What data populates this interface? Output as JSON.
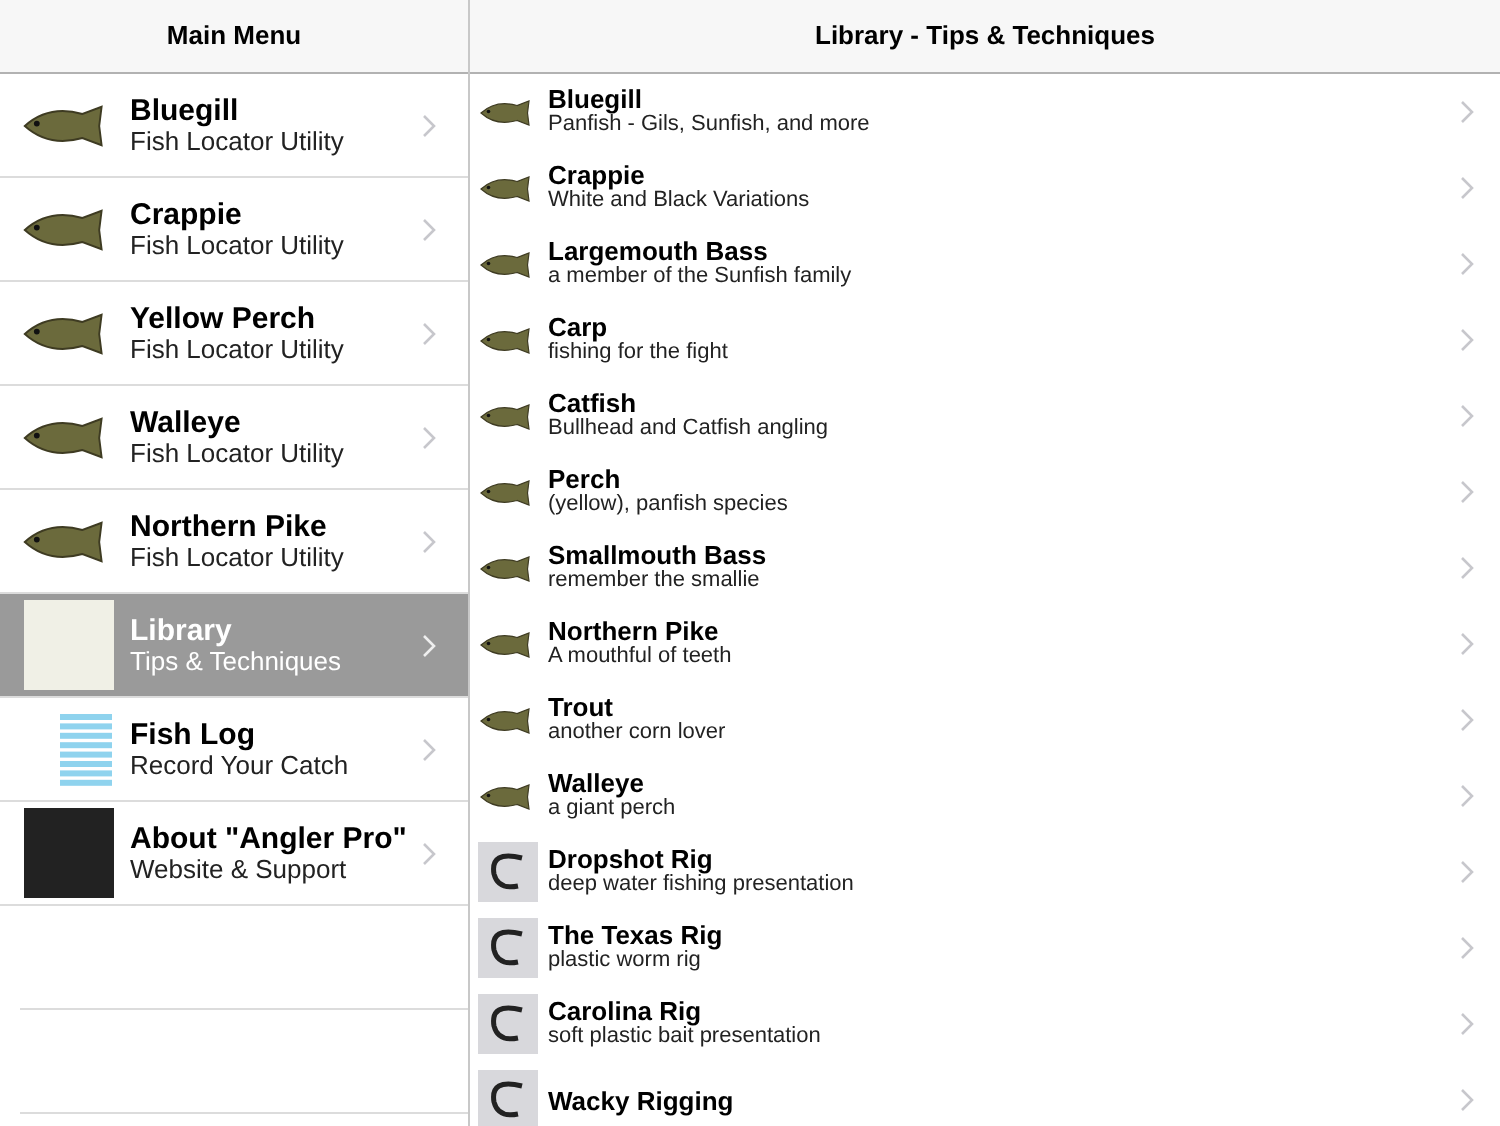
{
  "main_menu": {
    "title": "Main Menu",
    "items": [
      {
        "kind": "fish",
        "title": "Bluegill",
        "subtitle": "Fish Locator Utility",
        "selected": false
      },
      {
        "kind": "fish",
        "title": "Crappie",
        "subtitle": "Fish Locator Utility",
        "selected": false
      },
      {
        "kind": "fish",
        "title": "Yellow Perch",
        "subtitle": "Fish Locator Utility",
        "selected": false
      },
      {
        "kind": "fish",
        "title": "Walleye",
        "subtitle": "Fish Locator Utility",
        "selected": false
      },
      {
        "kind": "fish",
        "title": "Northern Pike",
        "subtitle": "Fish Locator Utility",
        "selected": false
      },
      {
        "kind": "collage",
        "title": "Library",
        "subtitle": "Tips & Techniques",
        "selected": true
      },
      {
        "kind": "log",
        "title": "Fish Log",
        "subtitle": "Record Your Catch",
        "selected": false
      },
      {
        "kind": "phones",
        "title": "About \"Angler Pro\"",
        "subtitle": "Website & Support",
        "selected": false
      }
    ]
  },
  "library": {
    "title": "Library - Tips & Techniques",
    "items": [
      {
        "kind": "fish",
        "title": "Bluegill",
        "subtitle": "Panfish - Gils, Sunfish, and more"
      },
      {
        "kind": "fish",
        "title": "Crappie",
        "subtitle": "White and Black Variations"
      },
      {
        "kind": "fish",
        "title": "Largemouth Bass",
        "subtitle": "a member of the Sunfish family"
      },
      {
        "kind": "fish",
        "title": "Carp",
        "subtitle": "fishing for the fight"
      },
      {
        "kind": "fish",
        "title": "Catfish",
        "subtitle": "Bullhead and Catfish angling"
      },
      {
        "kind": "fish",
        "title": "Perch",
        "subtitle": "(yellow), panfish species"
      },
      {
        "kind": "fish",
        "title": "Smallmouth Bass",
        "subtitle": "remember the smallie"
      },
      {
        "kind": "fish",
        "title": "Northern Pike",
        "subtitle": "A mouthful of teeth"
      },
      {
        "kind": "fish",
        "title": "Trout",
        "subtitle": "another corn lover"
      },
      {
        "kind": "fish",
        "title": "Walleye",
        "subtitle": "a giant perch"
      },
      {
        "kind": "rig",
        "title": "Dropshot Rig",
        "subtitle": "deep water fishing presentation"
      },
      {
        "kind": "rig",
        "title": "The Texas Rig",
        "subtitle": "plastic worm rig"
      },
      {
        "kind": "rig",
        "title": "Carolina Rig",
        "subtitle": "soft plastic bait presentation"
      },
      {
        "kind": "rig",
        "title": "Wacky Rigging"
      }
    ]
  }
}
